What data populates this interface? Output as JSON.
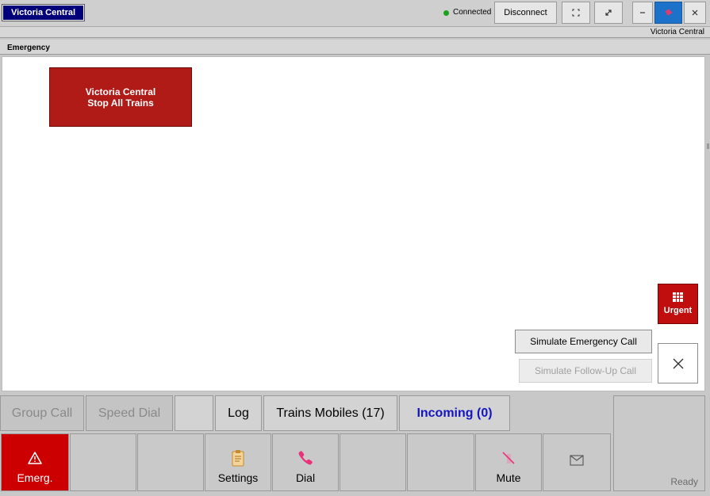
{
  "window": {
    "title": "Victoria Central",
    "status": "Connected",
    "status_color": "#1aa31a",
    "disconnect_label": "Disconnect",
    "location": "Victoria Central"
  },
  "panel": {
    "title": "Emergency",
    "tile": {
      "line1": "Victoria Central",
      "line2": "Stop All Trains"
    },
    "urgent_label": "Urgent",
    "simulate_emergency_label": "Simulate Emergency Call",
    "simulate_followup_label": "Simulate Follow-Up Call"
  },
  "tabs": [
    {
      "label": "Group Call",
      "enabled": false
    },
    {
      "label": "Speed Dial",
      "enabled": false
    },
    {
      "label": ""
    },
    {
      "label": "Log"
    },
    {
      "label": "Trains Mobiles (17)"
    },
    {
      "label": "Incoming (0)",
      "active": true
    }
  ],
  "bottom_buttons": [
    {
      "label": "Emerg.",
      "icon": "warning-icon"
    },
    {
      "label": ""
    },
    {
      "label": ""
    },
    {
      "label": "Settings",
      "icon": "clipboard-icon"
    },
    {
      "label": "Dial",
      "icon": "phone-icon"
    },
    {
      "label": ""
    },
    {
      "label": ""
    },
    {
      "label": "Mute",
      "icon": "mute-icon"
    },
    {
      "label": "",
      "icon": "envelope-icon"
    }
  ],
  "status_text": "Ready",
  "colors": {
    "accent_red": "#cc0000",
    "tile_red": "#b01a17",
    "title_blue": "#00007a",
    "pin_blue": "#1c72c8",
    "incoming_blue": "#1414c0"
  }
}
